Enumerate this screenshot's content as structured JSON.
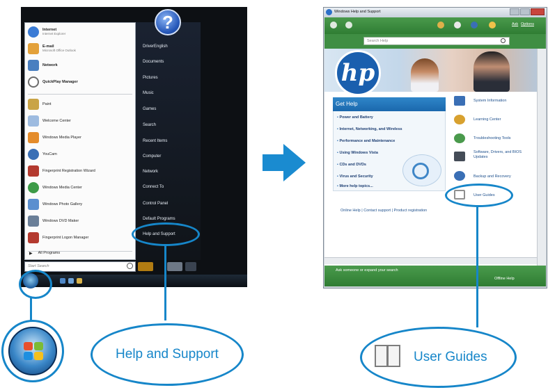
{
  "start_menu": {
    "pinned": [
      {
        "title": "Internet",
        "subtitle": "Internet Explorer",
        "icon": "internet-explorer-icon",
        "color": "#3a7bd5"
      },
      {
        "title": "E-mail",
        "subtitle": "Microsoft Office Outlook",
        "icon": "email-icon",
        "color": "#e3a13a"
      },
      {
        "title": "Network",
        "subtitle": "",
        "icon": "network-icon",
        "color": "#4a7fc0"
      },
      {
        "title": "QuickPlay Manager",
        "subtitle": "",
        "icon": "quickplay-icon",
        "color": "#6c6c6c"
      }
    ],
    "recent": [
      {
        "label": "Paint",
        "icon": "paint-icon",
        "color": "#c9a446"
      },
      {
        "label": "Welcome Center",
        "icon": "welcome-center-icon",
        "color": "#9dbbe0"
      },
      {
        "label": "Windows Media Player",
        "icon": "media-player-icon",
        "color": "#e48c2b"
      },
      {
        "label": "YouCam",
        "icon": "youcam-icon",
        "color": "#3a6fb5"
      },
      {
        "label": "Fingerprint Registration Wizard",
        "icon": "fingerprint-icon",
        "color": "#b43a2f"
      },
      {
        "label": "Windows Media Center",
        "icon": "media-center-icon",
        "color": "#3d9b48"
      },
      {
        "label": "Windows Photo Gallery",
        "icon": "photo-gallery-icon",
        "color": "#5b8fcf"
      },
      {
        "label": "Windows DVD Maker",
        "icon": "dvd-maker-icon",
        "color": "#6a7f98"
      },
      {
        "label": "Fingerprint Logon Manager",
        "icon": "fingerprint-logon-icon",
        "color": "#b43a2f"
      }
    ],
    "all_programs": "All Programs",
    "search_placeholder": "Start Search",
    "right_items": [
      "DriverEnglish",
      "Documents",
      "Pictures",
      "Music",
      "Games",
      "Search",
      "Recent Items",
      "Computer",
      "Network",
      "Connect To",
      "Control Panel",
      "Default Programs",
      "Help and Support"
    ]
  },
  "callouts": {
    "help_and_support": "Help and Support",
    "user_guides": "User Guides",
    "accent": "#1686c9"
  },
  "help_window": {
    "title": "Windows Help and Support",
    "toolbar_ask": "Ask",
    "toolbar_options": "Options",
    "search_placeholder": "Search Help",
    "logo": "hp",
    "get_help_title": "Get Help",
    "get_help_items": [
      "Power and Battery",
      "Internet, Networking, and Wireless",
      "Performance and Maintenance",
      "Using Windows Vista",
      "CDs and DVDs",
      "Virus and Security",
      "More help topics..."
    ],
    "right_links": [
      {
        "label": "System Information",
        "icon": "system-info-icon",
        "color": "#3a6fb5"
      },
      {
        "label": "Learning Center",
        "icon": "learning-center-icon",
        "color": "#d8a12f"
      },
      {
        "label": "Troubleshooting Tools",
        "icon": "troubleshooting-icon",
        "color": "#4a9a4c"
      },
      {
        "label": "Software, Drivers, and BIOS Updates",
        "icon": "software-updates-icon",
        "color": "#444c57"
      },
      {
        "label": "Backup and Recovery",
        "icon": "backup-recovery-icon",
        "color": "#3a6fb5"
      },
      {
        "label": "User Guides",
        "icon": "user-guides-icon",
        "color": "#8f8f8f"
      }
    ],
    "bottom_links": "Online Help  |  Contact support  |  Product registration",
    "status_text": "Ask someone or expand your search",
    "offline_label": "Offline Help"
  }
}
